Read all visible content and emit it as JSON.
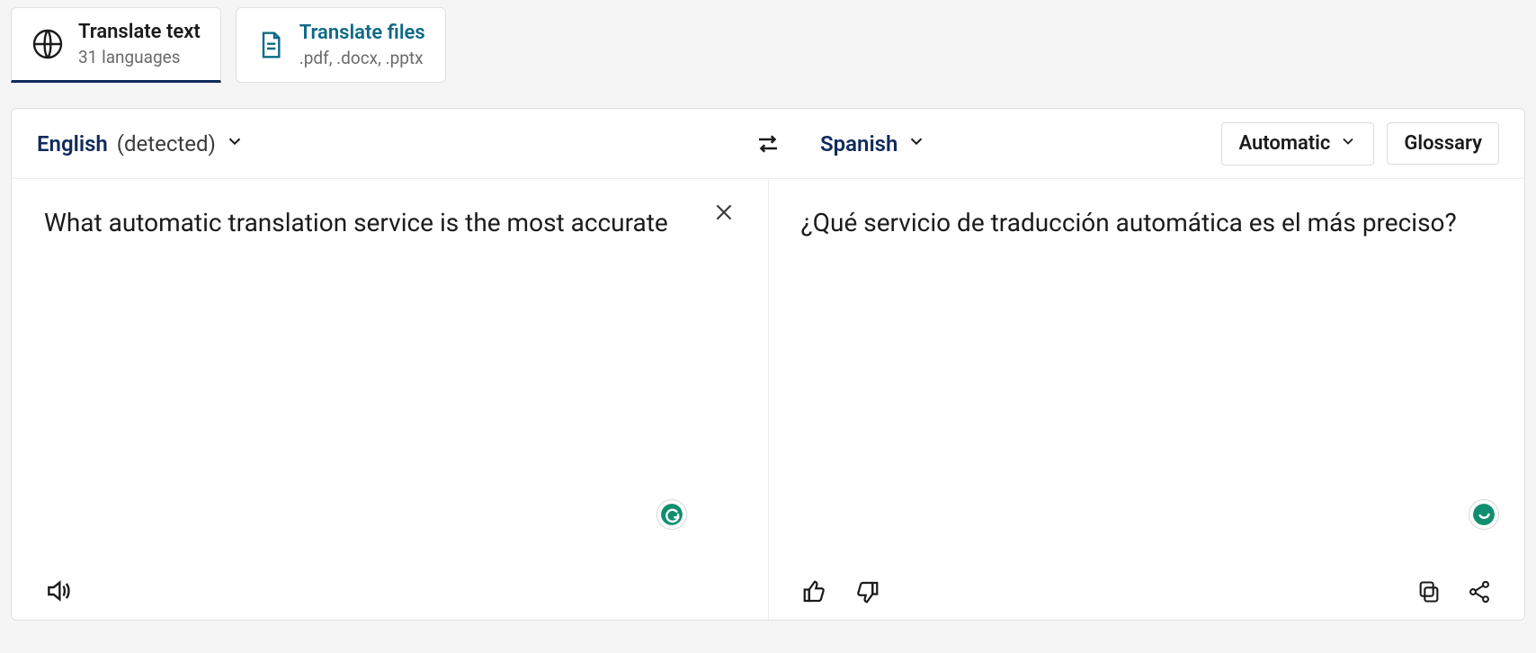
{
  "tabs": {
    "text": {
      "title": "Translate text",
      "sub": "31 languages"
    },
    "files": {
      "title": "Translate files",
      "sub": ".pdf, .docx, .pptx"
    }
  },
  "source": {
    "language": "English",
    "detected_suffix": "(detected)",
    "text": "What automatic translation service is the most accurate"
  },
  "target": {
    "language": "Spanish",
    "text": "¿Qué servicio de traducción automática es el más preciso?"
  },
  "controls": {
    "formality": "Automatic",
    "glossary": "Glossary"
  }
}
